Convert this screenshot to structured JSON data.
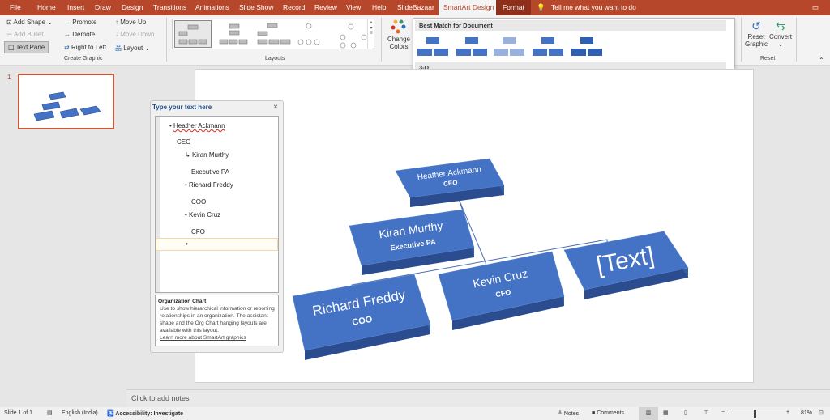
{
  "tabs": [
    "File",
    "Home",
    "Insert",
    "Draw",
    "Design",
    "Transitions",
    "Animations",
    "Slide Show",
    "Record",
    "Review",
    "View",
    "Help",
    "SlideBazaar",
    "SmartArt Design",
    "Format"
  ],
  "tell_me": "Tell me what you want to do",
  "ribbon": {
    "create_graphic": {
      "add_shape": "Add Shape",
      "add_bullet": "Add Bullet",
      "text_pane": "Text Pane",
      "promote": "Promote",
      "demote": "Demote",
      "right_to_left": "Right to Left",
      "move_up": "Move Up",
      "move_down": "Move Down",
      "layout": "Layout",
      "label": "Create Graphic"
    },
    "layouts_label": "Layouts",
    "change_colors": "Change Colors",
    "reset": {
      "reset_graphic": "Reset Graphic",
      "convert": "Convert",
      "label": "Reset"
    }
  },
  "gallery": {
    "best_match": "Best Match for Document",
    "three_d": "3-D"
  },
  "slide_number": "1",
  "text_pane": {
    "title": "Type your text here",
    "lines": [
      "Heather Ackmann",
      "CEO",
      "Kiran Murthy",
      "Executive PA",
      "Richard Freddy",
      "COO",
      "Kevin Cruz",
      "CFO"
    ],
    "info_title": "Organization Chart",
    "info_text": "Use to show hierarchical information or reporting relationships in an organization. The assistant shape and the Org Chart hanging layouts are available with this layout.",
    "learn_more": "Learn more about SmartArt graphics"
  },
  "chart": {
    "nodes": [
      {
        "name": "Heather Ackmann",
        "title": "CEO"
      },
      {
        "name": "Kiran Murthy",
        "title": "Executive PA"
      },
      {
        "name": "Richard Freddy",
        "title": "COO"
      },
      {
        "name": "Kevin Cruz",
        "title": "CFO"
      },
      {
        "name": "[Text]",
        "title": ""
      }
    ],
    "box_color": "#4472c4"
  },
  "notes_placeholder": "Click to add notes",
  "status": {
    "slide": "Slide 1 of 1",
    "language": "English (India)",
    "accessibility": "Accessibility: Investigate",
    "notes": "Notes",
    "comments": "Comments",
    "zoom": "81%"
  }
}
